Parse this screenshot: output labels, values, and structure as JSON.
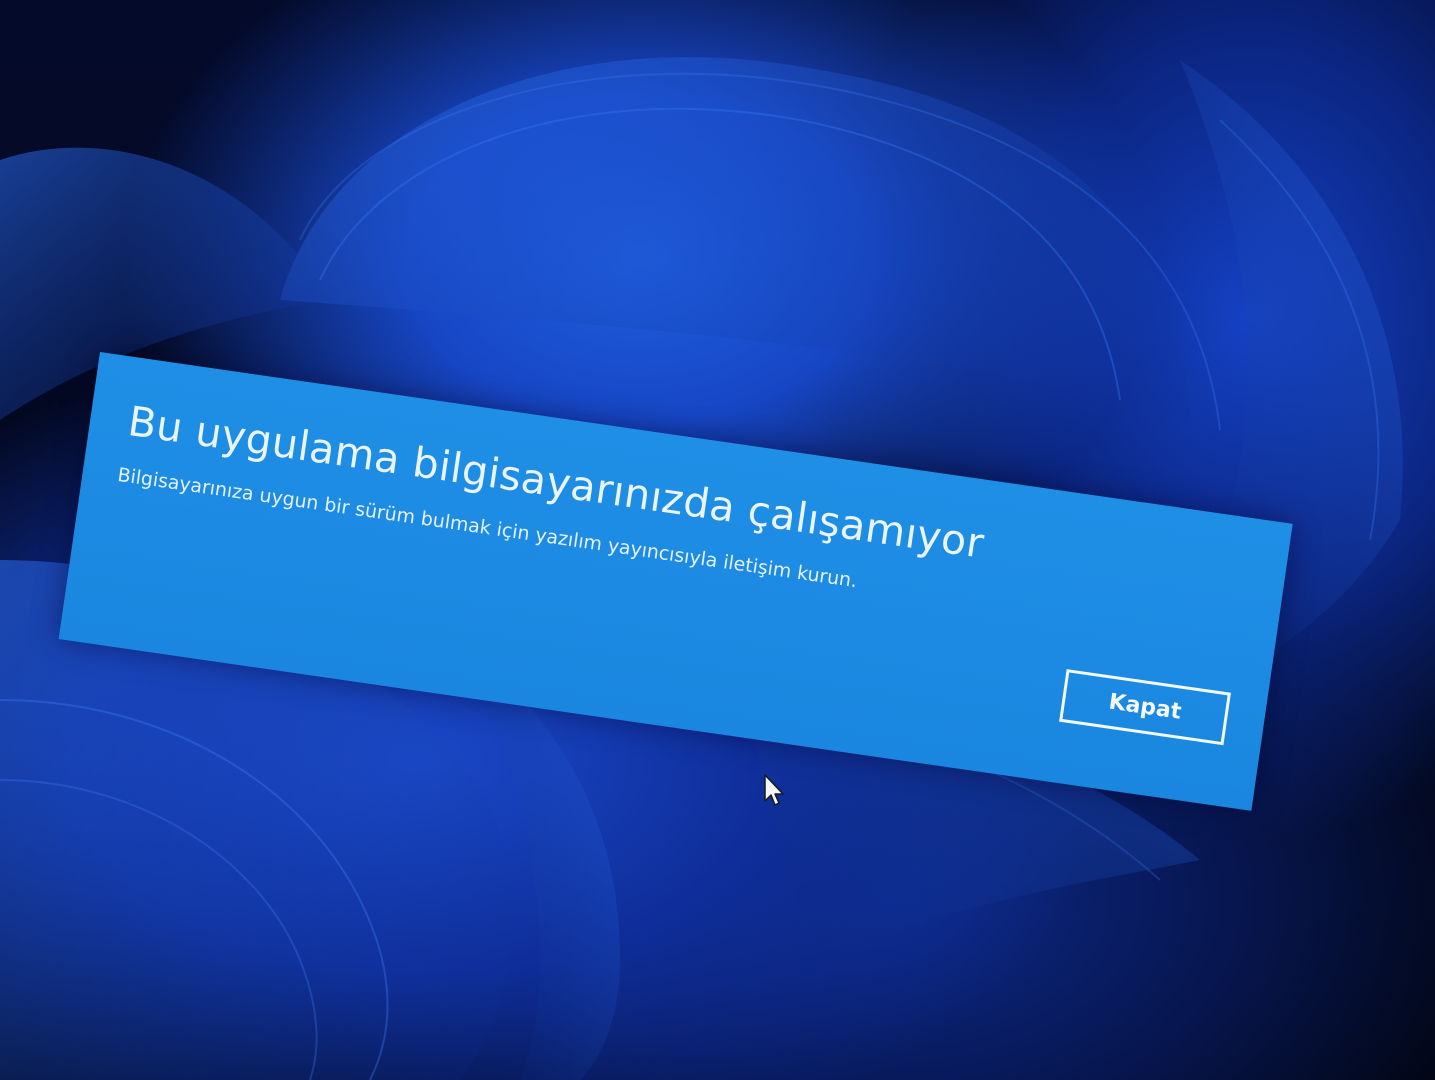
{
  "dialog": {
    "title": "Bu uygulama bilgisayarınızda çalışamıyor",
    "message": "Bilgisayarınıza uygun bir sürüm bulmak için yazılım yayıncısıyla iletişim kurun.",
    "close_label": "Kapat"
  },
  "colors": {
    "dialog_background": "#1a86df",
    "dialog_text": "#e9f4ff",
    "wallpaper_blue": "#1746c4",
    "wallpaper_dark": "#020614"
  },
  "icons": {
    "pointer": "mouse-pointer-icon"
  }
}
